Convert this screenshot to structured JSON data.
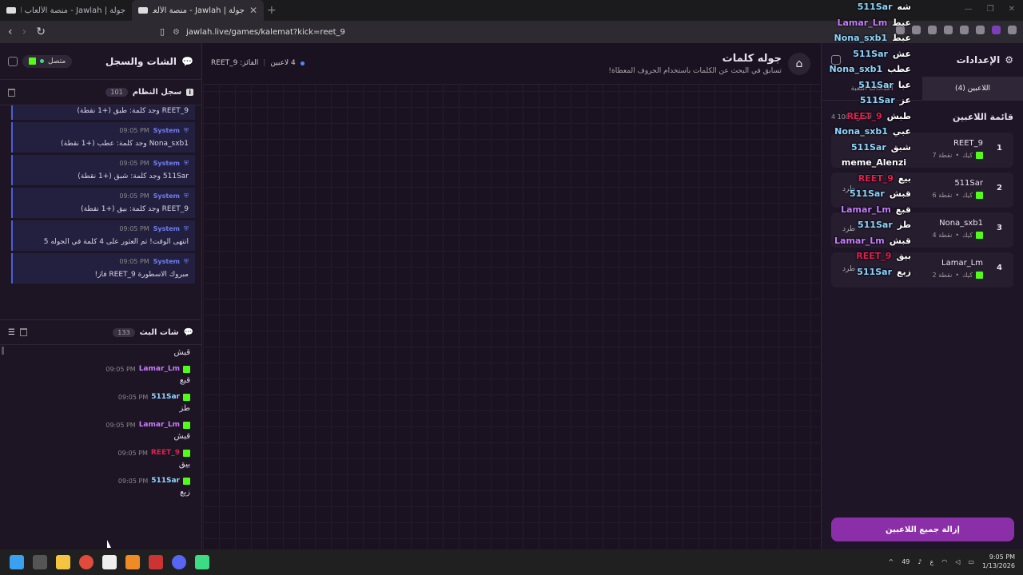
{
  "browser": {
    "tabs": [
      {
        "title": "جولة | Jawlah - منصة الألعاب التفاعلية",
        "active": false
      },
      {
        "title": "جولة | Jawlah - منصة الألعاب التفاعلية",
        "active": true
      }
    ],
    "url": "jawlah.live/games/kalemat?kick=reet_9"
  },
  "left": {
    "title": "الشات والسجل",
    "status": "متصل",
    "system_log": {
      "title": "سجل النظام",
      "count": "101",
      "entries": [
        {
          "sender": "",
          "time": "",
          "text": "REET_9 وجد كلمة: طبق (+1 نقطة)"
        },
        {
          "sender": "System",
          "time": "09:05 PM",
          "text": "Nona_sxb1 وجد كلمة: عطب (+1 نقطة)"
        },
        {
          "sender": "System",
          "time": "09:05 PM",
          "text": "511Sar وجد كلمة: شبق (+1 نقطة)"
        },
        {
          "sender": "System",
          "time": "09:05 PM",
          "text": "REET_9 وجد كلمة: بيق (+1 نقطة)"
        },
        {
          "sender": "System",
          "time": "09:05 PM",
          "text": "انتهى الوقت! تم العثور على 4 كلمة في الجوله 5"
        },
        {
          "sender": "System",
          "time": "09:05 PM",
          "text": "مبروك الاسطورة REET_9 فاز!"
        }
      ]
    },
    "stream_chat": {
      "title": "شات البث",
      "count": "133",
      "messages": [
        {
          "user": "",
          "time": "",
          "text": "قبش",
          "color": "#c77dff"
        },
        {
          "user": "Lamar_Lm",
          "time": "09:05 PM",
          "text": "قبع",
          "color": "#c77dff"
        },
        {
          "user": "511Sar",
          "time": "09:05 PM",
          "text": "طز",
          "color": "#8fd6ff"
        },
        {
          "user": "Lamar_Lm",
          "time": "09:05 PM",
          "text": "قبش",
          "color": "#c77dff"
        },
        {
          "user": "REET_9",
          "time": "09:05 PM",
          "text": "بيق",
          "color": "#e0214f"
        },
        {
          "user": "511Sar",
          "time": "09:05 PM",
          "text": "زبع",
          "color": "#8fd6ff"
        }
      ]
    }
  },
  "center": {
    "title": "جوله كلمات",
    "subtitle": "تسابق في البحث عن الكلمات باستخدام الحروف المعطاة!",
    "players_count": "4 لاعبين",
    "winner": "الفائز: REET_9"
  },
  "right": {
    "title": "الإعدادات",
    "tabs": [
      "اعدادات اللعبة",
      "اللاعبين (4)"
    ],
    "list_title": "قائمة اللاعبين",
    "list_sub": "4 لاعبين / 100",
    "players": [
      {
        "rank": "1",
        "name": "REET_9",
        "points": "7 نقطة",
        "platform": "كيك",
        "action": ""
      },
      {
        "rank": "2",
        "name": "511Sar",
        "points": "6 نقطة",
        "platform": "كيك",
        "action": "طرد"
      },
      {
        "rank": "3",
        "name": "Nona_sxb1",
        "points": "4 نقطة",
        "platform": "كيك",
        "action": "طرد"
      },
      {
        "rank": "4",
        "name": "Lamar_Lm",
        "points": "2 نقطة",
        "platform": "كيك",
        "action": "طرد"
      }
    ],
    "clear_button": "إزالة جميع اللاعبين"
  },
  "overlay": [
    {
      "user": "511Sar",
      "word": "شه",
      "color": "#8fd6ff"
    },
    {
      "user": "Lamar_Lm",
      "word": "عبط",
      "color": "#c77dff"
    },
    {
      "user": "Nona_sxb1",
      "word": "عبط",
      "color": "#8fd6ff"
    },
    {
      "user": "511Sar",
      "word": "عش",
      "color": "#8fd6ff"
    },
    {
      "user": "Nona_sxb1",
      "word": "عطب",
      "color": "#8fd6ff"
    },
    {
      "user": "511Sar",
      "word": "عبا",
      "color": "#8fd6ff"
    },
    {
      "user": "511Sar",
      "word": "عز",
      "color": "#8fd6ff"
    },
    {
      "user": "REET_9",
      "word": "طبش",
      "color": "#e0214f"
    },
    {
      "user": "Nona_sxb1",
      "word": "عبي",
      "color": "#8fd6ff"
    },
    {
      "user": "511Sar",
      "word": "شبق",
      "color": "#8fd6ff"
    },
    {
      "user": "meme_Alenzi",
      "word": "",
      "color": "#ffffff"
    },
    {
      "user": "REET_9",
      "word": "بيع",
      "color": "#e0214f"
    },
    {
      "user": "511Sar",
      "word": "قبش",
      "color": "#8fd6ff"
    },
    {
      "user": "Lamar_Lm",
      "word": "قبع",
      "color": "#c77dff"
    },
    {
      "user": "511Sar",
      "word": "طز",
      "color": "#8fd6ff"
    },
    {
      "user": "Lamar_Lm",
      "word": "قبش",
      "color": "#c77dff"
    },
    {
      "user": "REET_9",
      "word": "بيق",
      "color": "#e0214f"
    },
    {
      "user": "511Sar",
      "word": "زبع",
      "color": "#8fd6ff"
    }
  ],
  "taskbar": {
    "time": "9:05 PM",
    "date": "1/13/2026",
    "lang": "ع",
    "notif": "49"
  }
}
